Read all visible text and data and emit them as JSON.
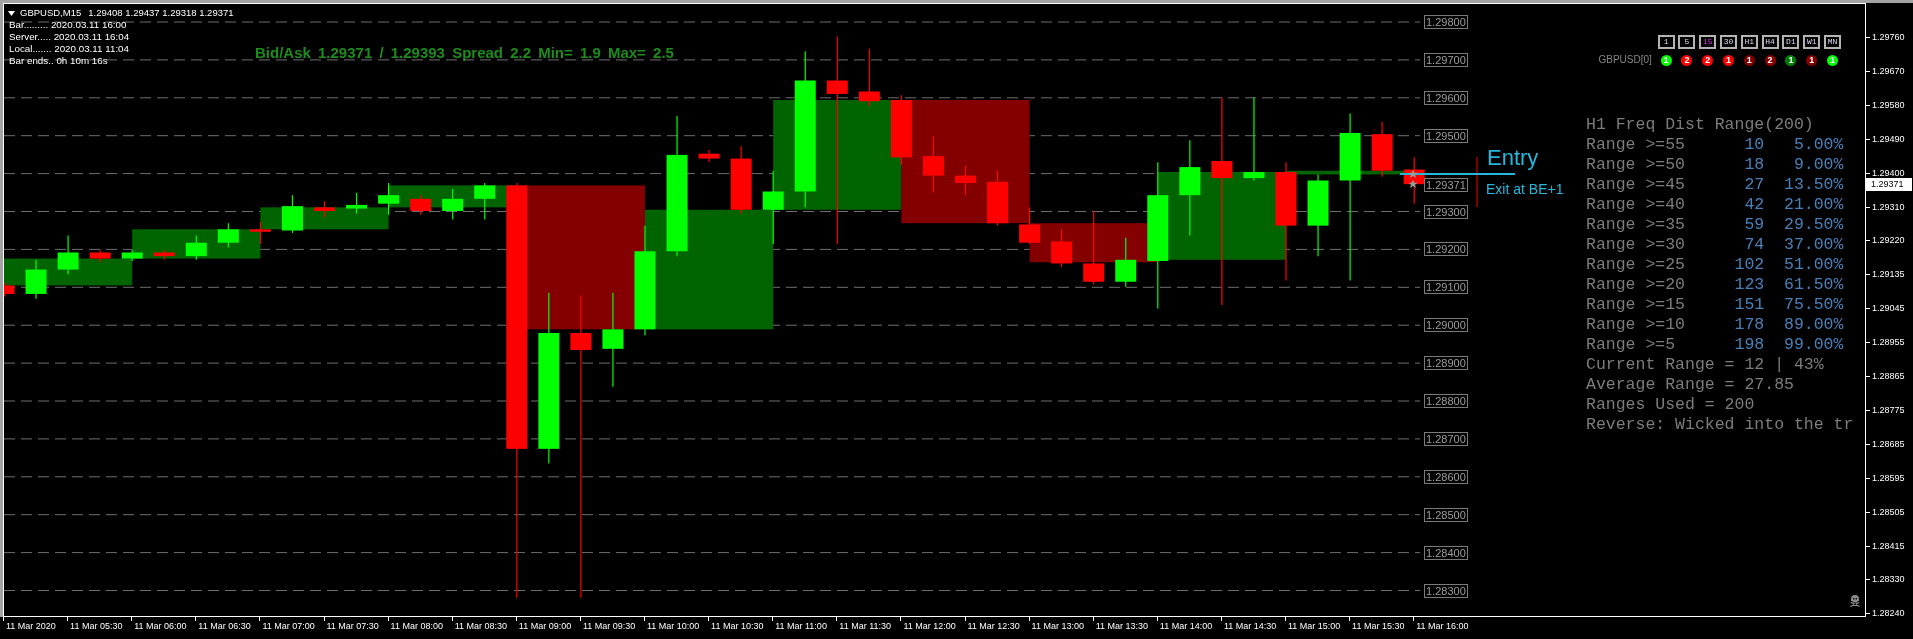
{
  "chart_header": {
    "symbol": "GBPUSD,M15",
    "ohlc": "1.29408 1.29437 1.29318 1.29371"
  },
  "info_lines": [
    "Bar......... 2020.03.11 16:00",
    "Server..... 2020.03.11 16:04",
    "Local....... 2020.03.11 11:04",
    "Bar ends.. 0h 10m 16s"
  ],
  "spread_text": "Bid/Ask 1.29371 / 1.29393 Spread 2.2 Min= 1.9 Max= 2.5",
  "timeframes": [
    {
      "label": "1",
      "selected": false
    },
    {
      "label": "5",
      "selected": false
    },
    {
      "label": "15",
      "selected": true
    },
    {
      "label": "30",
      "selected": false
    },
    {
      "label": "H1",
      "selected": false
    },
    {
      "label": "H4",
      "selected": false
    },
    {
      "label": "D1",
      "selected": false
    },
    {
      "label": "W1",
      "selected": false
    },
    {
      "label": "MN",
      "selected": false
    }
  ],
  "signals": {
    "symbol": "GBPUSD[0]",
    "items": [
      {
        "value": "1",
        "color": "#00ff00"
      },
      {
        "value": "2",
        "color": "#ff0000"
      },
      {
        "value": "2",
        "color": "#ff0000"
      },
      {
        "value": "1",
        "color": "#ff0000"
      },
      {
        "value": "1",
        "color": "#800000"
      },
      {
        "value": "2",
        "color": "#8b0000"
      },
      {
        "value": "1",
        "color": "#008000"
      },
      {
        "value": "1",
        "color": "#800000"
      },
      {
        "value": "1",
        "color": "#00ff00"
      }
    ]
  },
  "freq_table": {
    "title": "H1 Freq Dist Range(200)",
    "rows": [
      {
        "label": "Range >=55",
        "count": "10",
        "percent": "5.00%"
      },
      {
        "label": "Range >=50",
        "count": "18",
        "percent": "9.00%"
      },
      {
        "label": "Range >=45",
        "count": "27",
        "percent": "13.50%"
      },
      {
        "label": "Range >=40",
        "count": "42",
        "percent": "21.00%"
      },
      {
        "label": "Range >=35",
        "count": "59",
        "percent": "29.50%"
      },
      {
        "label": "Range >=30",
        "count": "74",
        "percent": "37.00%"
      },
      {
        "label": "Range >=25",
        "count": "102",
        "percent": "51.00%"
      },
      {
        "label": "Range >=20",
        "count": "123",
        "percent": "61.50%"
      },
      {
        "label": "Range >=15",
        "count": "151",
        "percent": "75.50%"
      },
      {
        "label": "Range >=10",
        "count": "178",
        "percent": "89.00%"
      },
      {
        "label": "Range >=5",
        "count": "198",
        "percent": "99.00%"
      }
    ],
    "summary": [
      "Current Range = 12 | 43%",
      "Average Range = 27.85",
      "Ranges Used = 200",
      "Reverse: Wicked into the tr"
    ]
  },
  "trade_labels": {
    "entry": "Entry",
    "exit": "Exit at BE+1"
  },
  "grid_labels": [
    "1.29800",
    "1.29700",
    "1.29600",
    "1.29500",
    "1.29300",
    "1.29200",
    "1.29100",
    "1.29000",
    "1.28900",
    "1.28800",
    "1.28700",
    "1.28600",
    "1.28500",
    "1.28400",
    "1.28300"
  ],
  "bid_line_label": "1.29371",
  "price_axis": {
    "labels": [
      "1.29760",
      "1.29670",
      "1.29580",
      "1.29490",
      "1.29400",
      "1.29310",
      "1.29220",
      "1.29135",
      "1.29045",
      "1.28955",
      "1.28865",
      "1.28775",
      "1.28685",
      "1.28595",
      "1.28505",
      "1.28415",
      "1.28330",
      "1.28240"
    ],
    "current": "1.29371"
  },
  "time_axis": [
    "11 Mar 2020",
    "11 Mar 05:30",
    "11 Mar 06:00",
    "11 Mar 06:30",
    "11 Mar 07:00",
    "11 Mar 07:30",
    "11 Mar 08:00",
    "11 Mar 08:30",
    "11 Mar 09:00",
    "11 Mar 09:30",
    "11 Mar 10:00",
    "11 Mar 10:30",
    "11 Mar 11:00",
    "11 Mar 11:30",
    "11 Mar 12:00",
    "11 Mar 12:30",
    "11 Mar 13:00",
    "11 Mar 13:30",
    "11 Mar 14:00",
    "11 Mar 14:30",
    "11 Mar 15:00",
    "11 Mar 15:30",
    "11 Mar 16:00"
  ]
}
